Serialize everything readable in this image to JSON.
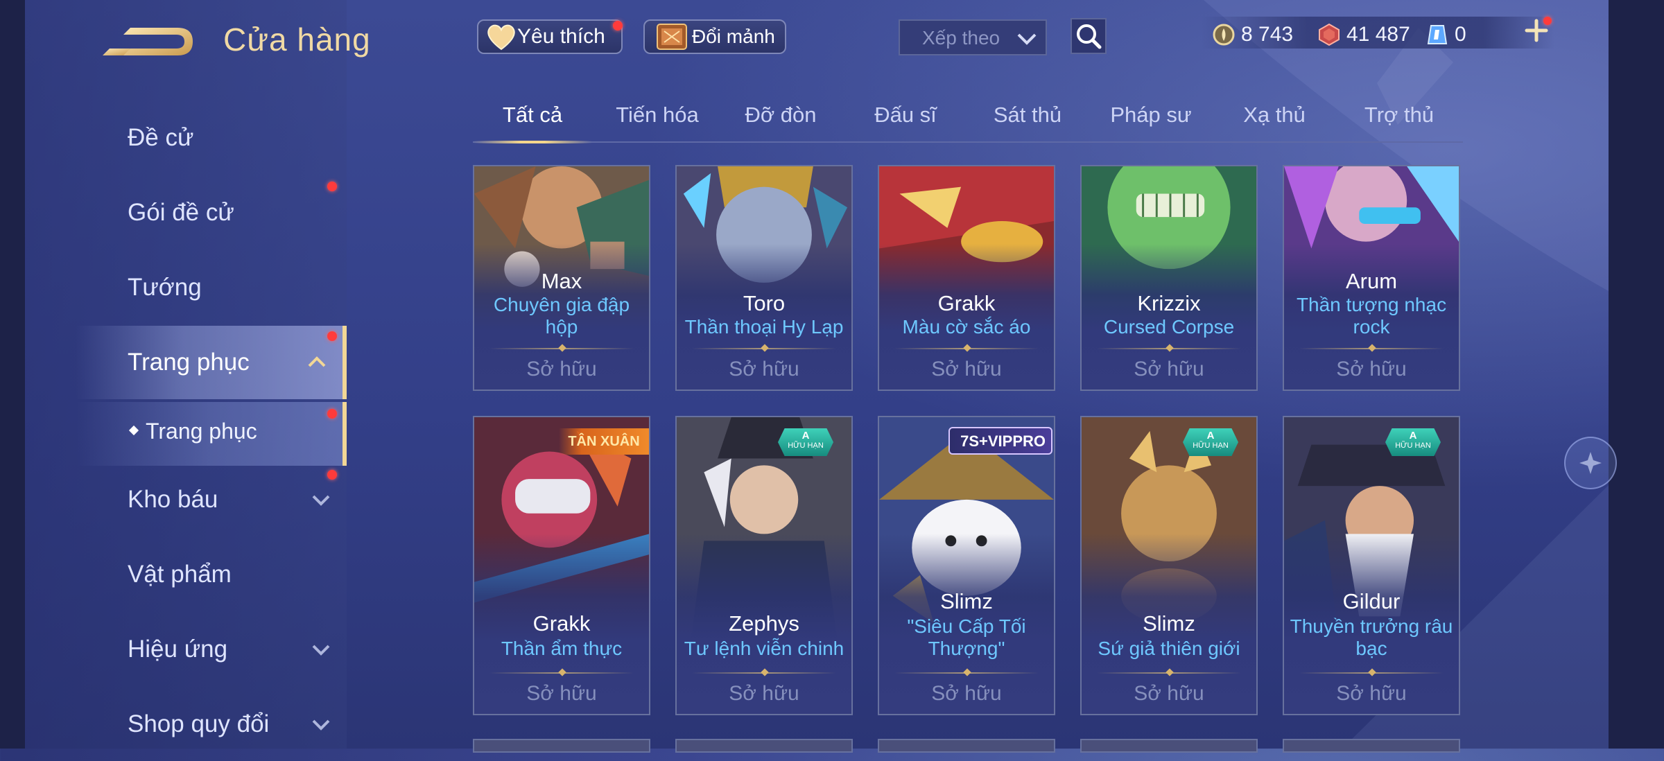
{
  "header": {
    "title": "Cửa hàng",
    "favorite_label": "Yêu thích",
    "exchange_label": "Đổi mảnh",
    "sort_placeholder": "Xếp theo"
  },
  "currencies": [
    {
      "icon": "gold-coin-icon",
      "value": "8 743"
    },
    {
      "icon": "red-voucher-icon",
      "value": "41 487"
    },
    {
      "icon": "crystal-icon",
      "value": "0"
    }
  ],
  "sidebar": {
    "items": [
      {
        "label": "Đề cử"
      },
      {
        "label": "Gói đề cử"
      },
      {
        "label": "Tướng"
      },
      {
        "label": "Trang phục"
      },
      {
        "label": "Trang phục"
      },
      {
        "label": "Kho báu"
      },
      {
        "label": "Vật phẩm"
      },
      {
        "label": "Hiệu ứng"
      },
      {
        "label": "Shop quy đổi"
      }
    ]
  },
  "tabs": [
    "Tất cả",
    "Tiến hóa",
    "Đỡ đòn",
    "Đấu sĩ",
    "Sát thủ",
    "Pháp sư",
    "Xạ thủ",
    "Trợ thủ"
  ],
  "owned_label": "Sở hữu",
  "cards": [
    {
      "hero": "Max",
      "skin": "Chuyên gia đập hộp",
      "badge": ""
    },
    {
      "hero": "Toro",
      "skin": "Thần thoại Hy Lạp",
      "badge": ""
    },
    {
      "hero": "Grakk",
      "skin": "Màu cờ sắc áo",
      "badge": ""
    },
    {
      "hero": "Krizzix",
      "skin": "Cursed Corpse",
      "badge": ""
    },
    {
      "hero": "Arum",
      "skin": "Thần tượng nhạc rock",
      "badge": ""
    },
    {
      "hero": "Grakk",
      "skin": "Thần ẩm thực",
      "badge": "TÂN XUÂN"
    },
    {
      "hero": "Zephys",
      "skin": "Tư lệnh viễn chinh",
      "badge": "A HỮU HẠN"
    },
    {
      "hero": "Slimz",
      "skin": "\"Siêu Cấp Tối Thượng\"",
      "badge": "7S+VIPPRO"
    },
    {
      "hero": "Slimz",
      "skin": "Sứ giả thiên giới",
      "badge": "A HỮU HẠN"
    },
    {
      "hero": "Gildur",
      "skin": "Thuyền trưởng râu bạc",
      "badge": "A HỮU HẠN"
    }
  ],
  "badges": {
    "a_top": "A",
    "a_bottom": "HỮU HẠN",
    "tanxuan": "TÂN XUÂN",
    "vip": "7S+VIPPRO"
  },
  "colors": {
    "accent_gold": "#f2d796",
    "skin_text": "#6ec8ff",
    "notify_dot": "#ff3b3b"
  }
}
